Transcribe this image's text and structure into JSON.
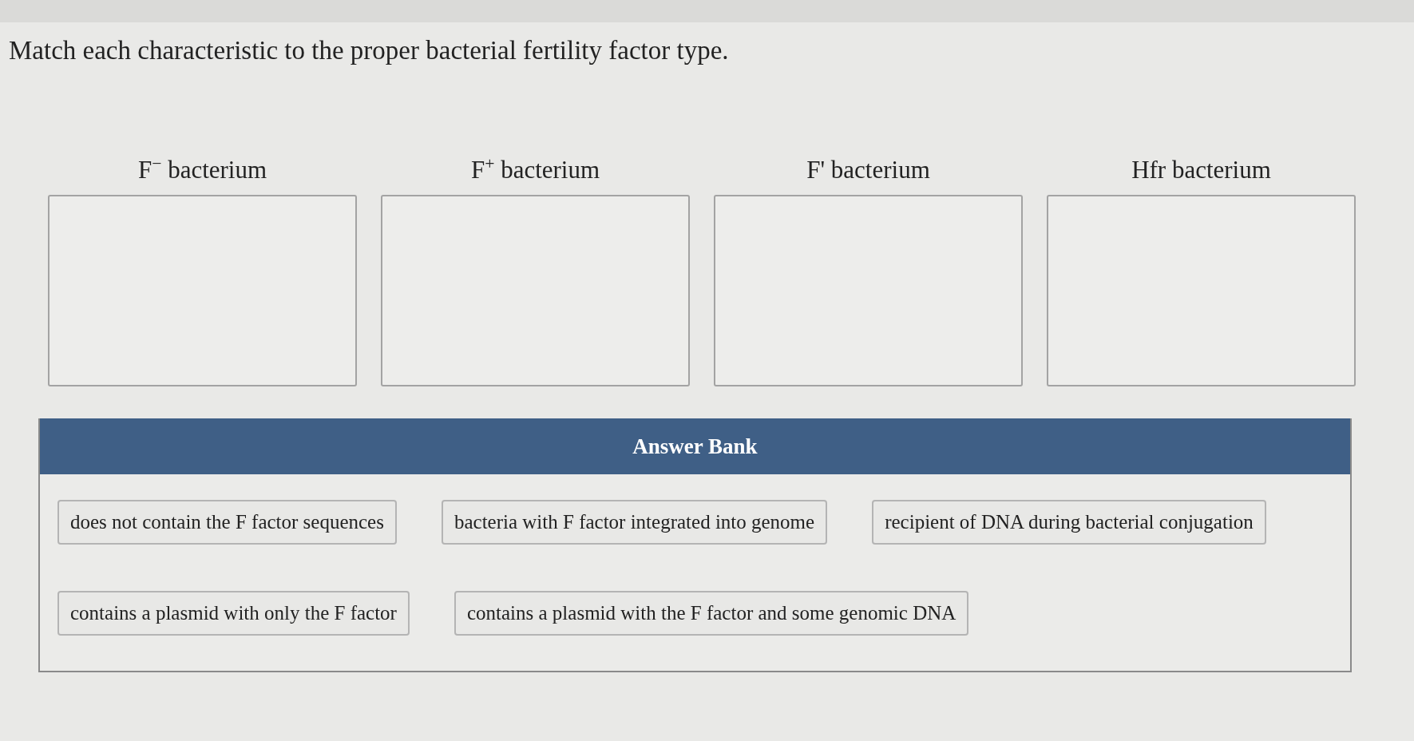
{
  "prompt": "Match each characteristic to the proper bacterial fertility factor type.",
  "categories": [
    {
      "label": "F$^{−}$ bacterium"
    },
    {
      "label": "F$^{+}$ bacterium"
    },
    {
      "label": "F' bacterium"
    },
    {
      "label": "Hfr bacterium"
    }
  ],
  "answer_bank": {
    "title": "Answer Bank",
    "rows": [
      {
        "tiles": [
          "does not contain the F factor sequences",
          "bacteria with F factor integrated into genome",
          "recipient of DNA during bacterial conjugation"
        ]
      },
      {
        "tiles": [
          "contains a plasmid with only the F factor",
          "contains a plasmid with the F factor and some genomic DNA"
        ]
      }
    ]
  }
}
